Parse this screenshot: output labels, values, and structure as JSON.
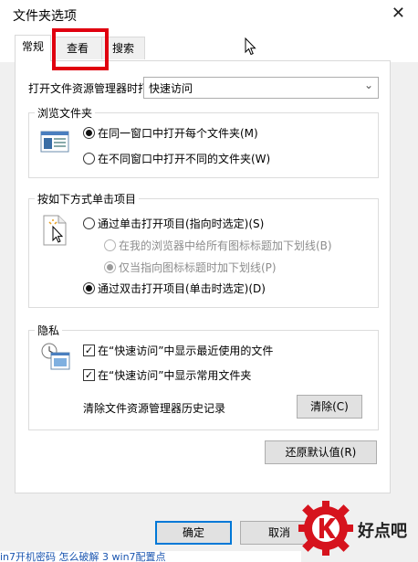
{
  "window": {
    "title": "文件夹选项",
    "close_glyph": "✕"
  },
  "tabs": [
    {
      "label": "常规",
      "active": true
    },
    {
      "label": "查看",
      "active": false
    },
    {
      "label": "搜索",
      "active": false
    }
  ],
  "open_explorer": {
    "label": "打开文件资源管理器时打",
    "value": "快速访问"
  },
  "browse_folders": {
    "title": "浏览文件夹",
    "options": [
      {
        "label": "在同一窗口中打开每个文件夹(M)",
        "selected": true
      },
      {
        "label": "在不同窗口中打开不同的文件夹(W)",
        "selected": false
      }
    ]
  },
  "click_items": {
    "title": "按如下方式单击项目",
    "single": {
      "label": "通过单击打开项目(指向时选定)(S)",
      "selected": false
    },
    "sub_options": [
      {
        "label": "在我的浏览器中给所有图标标题加下划线(B)",
        "selected": false,
        "disabled": true
      },
      {
        "label": "仅当指向图标标题时加下划线(P)",
        "selected": true,
        "disabled": true
      }
    ],
    "double": {
      "label": "通过双击打开项目(单击时选定)(D)",
      "selected": true
    }
  },
  "privacy": {
    "title": "隐私",
    "checks": [
      {
        "label": "在“快速访问”中显示最近使用的文件",
        "checked": true
      },
      {
        "label": "在“快速访问”中显示常用文件夹",
        "checked": true
      }
    ],
    "clear_label": "清除文件资源管理器历史记录",
    "clear_button": "清除(C)"
  },
  "restore_button": "还原默认值(R)",
  "footer": {
    "ok": "确定",
    "cancel": "取消"
  },
  "watermark": {
    "text": "好点吧"
  },
  "background": {
    "bottom_text": "in7开机密码 怎么破解   3  win7配置点"
  },
  "colors": {
    "highlight_box": "#e0000f",
    "focus_border": "#0078d7",
    "watermark_red": "#d6131d"
  }
}
